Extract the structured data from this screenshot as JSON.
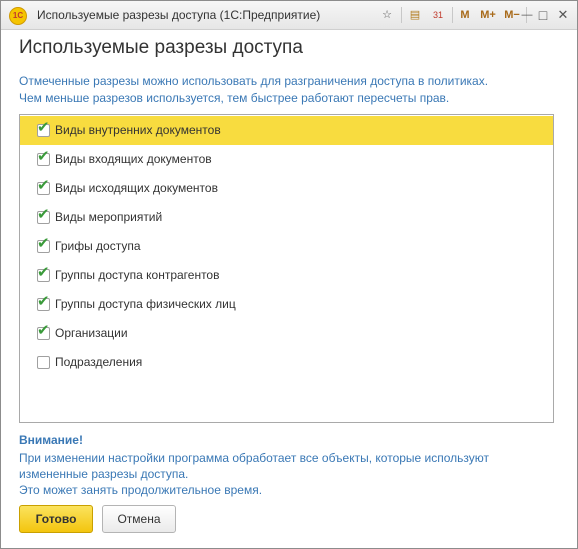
{
  "window": {
    "title": "Используемые разрезы доступа  (1С:Предприятие)"
  },
  "titlebar": {
    "logo_text": "1С",
    "buttons": {
      "star": "☆",
      "doc": "▤",
      "calendar": "31",
      "m": "M",
      "m_plus": "M+",
      "m_minus": "M−",
      "minimize": "—",
      "maximize": "□",
      "close": "✕"
    }
  },
  "heading": "Используемые разрезы доступа",
  "info": {
    "line1": "Отмеченные разрезы можно использовать для разграничения доступа в политиках.",
    "line2": "Чем меньше разрезов используется, тем быстрее работают пересчеты прав."
  },
  "items": [
    {
      "label": "Виды внутренних документов",
      "checked": true,
      "selected": true
    },
    {
      "label": "Виды входящих документов",
      "checked": true,
      "selected": false
    },
    {
      "label": "Виды исходящих документов",
      "checked": true,
      "selected": false
    },
    {
      "label": "Виды мероприятий",
      "checked": true,
      "selected": false
    },
    {
      "label": "Грифы доступа",
      "checked": true,
      "selected": false
    },
    {
      "label": "Группы доступа контрагентов",
      "checked": true,
      "selected": false
    },
    {
      "label": "Группы доступа физических лиц",
      "checked": true,
      "selected": false
    },
    {
      "label": "Организации",
      "checked": true,
      "selected": false
    },
    {
      "label": "Подразделения",
      "checked": false,
      "selected": false
    }
  ],
  "warning": {
    "title": "Внимание!",
    "line1": "При изменении настройки программа обработает все объекты, которые используют",
    "line2": "измененные разрезы доступа.",
    "line3": "Это может занять продолжительное время."
  },
  "buttons": {
    "ok": "Готово",
    "cancel": "Отмена"
  },
  "check_glyph": "✔",
  "colors": {
    "accent": "#f8dc3f",
    "link": "#3a78b5",
    "check": "#3a9a3a"
  }
}
